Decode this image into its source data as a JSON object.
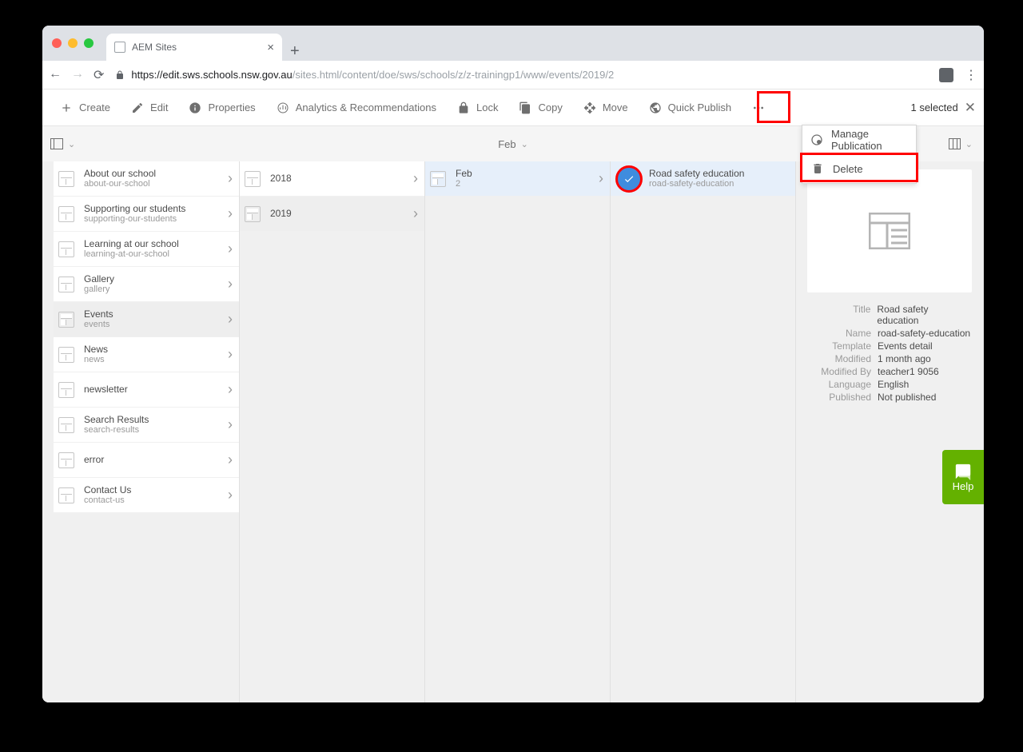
{
  "browser": {
    "tab_title": "AEM Sites",
    "url_host": "https://edit.sws.schools.nsw.gov.au",
    "url_path": "/sites.html/content/doe/sws/schools/z/z-trainingp1/www/events/2019/2"
  },
  "toolbar": {
    "create": "Create",
    "edit": "Edit",
    "properties": "Properties",
    "analytics": "Analytics & Recommendations",
    "lock": "Lock",
    "copy": "Copy",
    "move": "Move",
    "quick_publish": "Quick Publish",
    "selected": "1 selected"
  },
  "dropdown": {
    "manage_publication": "Manage Publication",
    "delete": "Delete"
  },
  "breadcrumb": "Feb",
  "columns": {
    "c1": [
      {
        "title": "About our school",
        "slug": "about-our-school"
      },
      {
        "title": "Supporting our students",
        "slug": "supporting-our-students"
      },
      {
        "title": "Learning at our school",
        "slug": "learning-at-our-school"
      },
      {
        "title": "Gallery",
        "slug": "gallery"
      },
      {
        "title": "Events",
        "slug": "events",
        "selected": true
      },
      {
        "title": "News",
        "slug": "news"
      },
      {
        "title": "newsletter",
        "slug": ""
      },
      {
        "title": "Search Results",
        "slug": "search-results"
      },
      {
        "title": "error",
        "slug": ""
      },
      {
        "title": "Contact Us",
        "slug": "contact-us"
      }
    ],
    "c2": [
      {
        "title": "2018"
      },
      {
        "title": "2019",
        "selected": true
      }
    ],
    "c3": [
      {
        "title": "Feb",
        "slug": "2",
        "selected": true
      }
    ],
    "c4": [
      {
        "title": "Road safety education",
        "slug": "road-safety-education",
        "checked": true
      }
    ]
  },
  "preview": {
    "title_k": "Title",
    "title_v": "Road safety education",
    "name_k": "Name",
    "name_v": "road-safety-education",
    "template_k": "Template",
    "template_v": "Events detail",
    "modified_k": "Modified",
    "modified_v": "1 month ago",
    "modifiedby_k": "Modified By",
    "modifiedby_v": "teacher1 9056",
    "language_k": "Language",
    "language_v": "English",
    "published_k": "Published",
    "published_v": "Not published"
  },
  "help": "Help"
}
